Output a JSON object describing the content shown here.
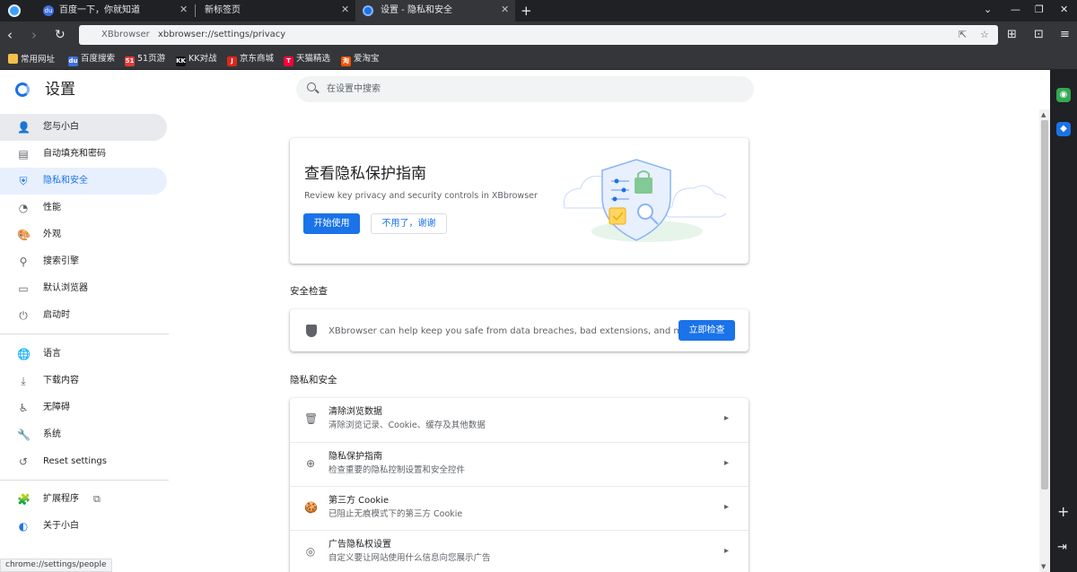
{
  "tabs": [
    {
      "title": "百度一下，你就知道",
      "favicon": "baidu-favicon"
    },
    {
      "title": "新标签页",
      "favicon": "none"
    },
    {
      "title": "设置 - 隐私和安全",
      "favicon": "settings-favicon",
      "active": true
    }
  ],
  "toolbar": {
    "omnibox_host": "XBbrowser",
    "omnibox_url": "xbbrowser://settings/privacy"
  },
  "bookmarks": [
    "常用网址",
    "百度搜索",
    "51页游",
    "KK对战",
    "京东商城",
    "天猫精选",
    "爱淘宝"
  ],
  "settings": {
    "title": "设置",
    "search_placeholder": "在设置中搜索"
  },
  "nav": {
    "items": [
      {
        "label": "您与小白",
        "icon": "person-icon"
      },
      {
        "label": "自动填充和密码",
        "icon": "clipboard-icon"
      },
      {
        "label": "隐私和安全",
        "icon": "shield-icon",
        "active": true
      },
      {
        "label": "性能",
        "icon": "speedometer-icon"
      },
      {
        "label": "外观",
        "icon": "palette-icon"
      },
      {
        "label": "搜索引擎",
        "icon": "search-icon"
      },
      {
        "label": "默认浏览器",
        "icon": "browser-window-icon"
      },
      {
        "label": "启动时",
        "icon": "power-icon"
      },
      {
        "label": "语言",
        "icon": "globe-icon"
      },
      {
        "label": "下载内容",
        "icon": "download-icon"
      },
      {
        "label": "无障碍",
        "icon": "accessibility-icon"
      },
      {
        "label": "系统",
        "icon": "wrench-icon"
      },
      {
        "label": "Reset settings",
        "icon": "history-icon"
      },
      {
        "label": "扩展程序",
        "icon": "puzzle-icon"
      },
      {
        "label": "关于小白",
        "icon": "browser-logo-icon"
      }
    ]
  },
  "status_url": "chrome://settings/people",
  "promo": {
    "title": "查看隐私保护指南",
    "subtitle": "Review key privacy and security controls in XBbrowser",
    "start_button": "开始使用",
    "dismiss_button": "不用了，谢谢"
  },
  "safety_check": {
    "heading": "安全检查",
    "text": "XBbrowser can help keep you safe from data breaches, bad extensions, and more",
    "button": "立即检查"
  },
  "privacy": {
    "heading": "隐私和安全",
    "rows": [
      {
        "title": "清除浏览数据",
        "subtitle": "清除浏览记录、Cookie、缓存及其他数据",
        "icon": "trash-icon"
      },
      {
        "title": "隐私保护指南",
        "subtitle": "检查重要的隐私控制设置和安全控件",
        "icon": "compass-icon"
      },
      {
        "title": "第三方 Cookie",
        "subtitle": "已阻止无痕模式下的第三方 Cookie",
        "icon": "cookie-icon"
      },
      {
        "title": "广告隐私权设置",
        "subtitle": "自定义要让网站使用什么信息向您展示广告",
        "icon": "ad-privacy-icon"
      }
    ]
  },
  "colors": {
    "accent": "#1a73e8",
    "nav_active_bg": "#e8f0fe",
    "dark_chrome": "#202124",
    "toolbar": "#35363a"
  }
}
